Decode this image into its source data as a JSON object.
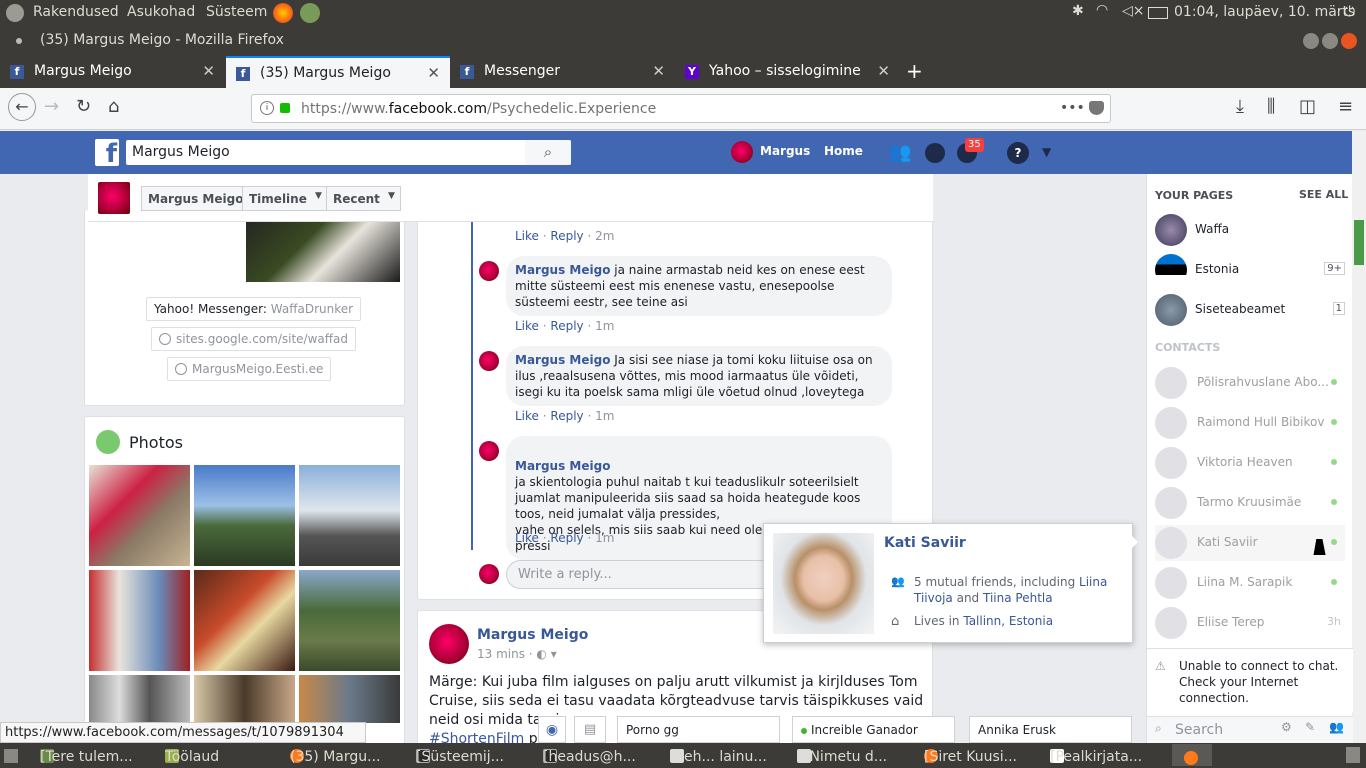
{
  "os": {
    "menus": [
      "Rakendused",
      "Asukohad",
      "Süsteem"
    ],
    "clock": "01:04, laupäev, 10. märts"
  },
  "window": {
    "title": "(35) Margus Meigo - Mozilla Firefox"
  },
  "tabs": [
    {
      "label": "Margus Meigo",
      "active": false
    },
    {
      "label": "(35) Margus Meigo",
      "active": true
    },
    {
      "label": "Messenger",
      "active": false
    },
    {
      "label": "Yahoo – sisselogimine",
      "active": false
    }
  ],
  "nav": {
    "url_prefix": "https://www.",
    "url_domain": "facebook.com",
    "url_path": "/Psychedelic.Experience",
    "more": "•••"
  },
  "fb": {
    "search_value": "Margus Meigo",
    "user": "Margus",
    "home": "Home",
    "notif_count": "35"
  },
  "page_header": {
    "name": "Margus Meigo",
    "timeline": "Timeline",
    "recent": "Recent"
  },
  "intro": {
    "yahoo_label": "Yahoo! Messenger:",
    "yahoo_value": "WaffaDrunker",
    "site1": "sites.google.com/site/waffad",
    "site2": "MargusMeigo.Eesti.ee"
  },
  "photos": {
    "title": "Photos"
  },
  "comments": [
    {
      "name": "Margus Meigo",
      "text": "ja naine armastab neid kes on enese eest mitte süsteemi eest mis enenese vastu, enesepoolse süsteemi eestr, see teine asi",
      "time": "1m"
    },
    {
      "name": "Margus Meigo",
      "text": "Ja sisi see niase ja tomi koku liituise osa on ilus ,reaalsusena võttes, mis mood iarmaatus üle võideti, isegi ku ita poelsk sama mligi üle võetud olnud ,loveytega",
      "time": "1m"
    },
    {
      "name": "Margus Meigo",
      "text": "ja skientologia puhul naitab t kui teaduslikulr soteerilsielt juamlat manipuleerida siis saad sa hoida heategude koos toos, neid jumalat välja pressides,\nvahe on selels, mis siis saab kui need olema hakavad kes ei pressi",
      "time": "1m"
    }
  ],
  "first_actions": {
    "like": "Like",
    "reply": "Reply",
    "time": "2m"
  },
  "action_like": "Like",
  "action_reply": "Reply",
  "reply_placeholder": "Write a reply...",
  "post": {
    "author": "Margus Meigo",
    "time": "13 mins",
    "text": "Märge: Kui juba film ialguses on palju arutt vilkumist ja kirjlduses Tom Cruise, siis seda ei tasu vaadata kõrgteadvuse tarvis täispikkuses vaid neid osi mida tarvis",
    "hashtag": "#ShortenFilm",
    "tail": "pro"
  },
  "hovercard": {
    "name": "Kati Saviir",
    "mutual_prefix": "5 mutual friends, including",
    "friend1": "Liina Tiivoja",
    "and": "and",
    "friend2": "Tiina Pehtla",
    "lives_prefix": "Lives in",
    "lives_place": "Tallinn, Estonia"
  },
  "sidebar": {
    "your_pages": "YOUR PAGES",
    "see_all": "SEE ALL",
    "pages": [
      {
        "name": "Waffa",
        "badge": ""
      },
      {
        "name": "Estonia",
        "badge": "9+"
      },
      {
        "name": "Siseteabeamet",
        "badge": "1"
      }
    ],
    "contacts_label": "CONTACTS",
    "contacts": [
      {
        "name": "Põlisrahvuslane Abo...",
        "status": "online"
      },
      {
        "name": "Raimond Hull Bibikov",
        "status": "online"
      },
      {
        "name": "Viktoria Heaven",
        "status": "online"
      },
      {
        "name": "Tarmo Kruusimäe",
        "status": "online"
      },
      {
        "name": "Kati Saviir",
        "status": "online"
      },
      {
        "name": "Liina M. Sarapik",
        "status": "online"
      },
      {
        "name": "Eliise Terep",
        "status": "3h"
      }
    ],
    "chat_error": "Unable to connect to chat. Check your Internet connection.",
    "search_placeholder": "Search"
  },
  "chat_tabs": [
    "Porno gg",
    "Increible Ganador",
    "Annika Erusk"
  ],
  "status_url": "https://www.facebook.com/messages/t/1079891304",
  "taskbar": [
    "[Tere tulem...",
    "Töölaud",
    "(35) Margu...",
    "[Süsteemij...",
    "[headus@h...",
    "[oeh... lainu...",
    "[*Nimetu d...",
    "[Siret Kuusi...",
    "[Pealkirjata..."
  ]
}
